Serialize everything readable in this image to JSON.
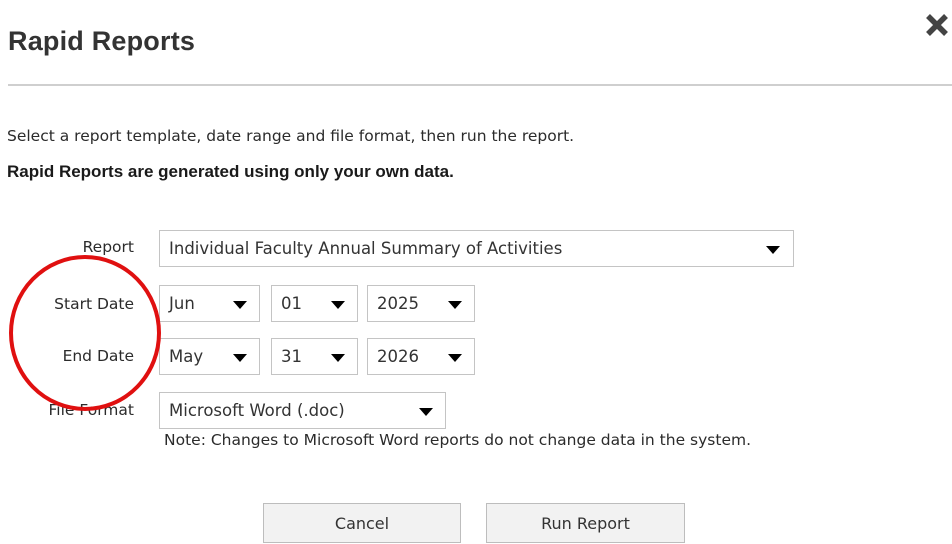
{
  "dialog": {
    "title": "Rapid Reports",
    "close_icon": "close-icon",
    "intro_text": "Select a report template, date range and file format, then run the report.",
    "intro_bold": "Rapid Reports are generated using only your own data."
  },
  "form": {
    "report": {
      "label": "Report",
      "value": "Individual Faculty Annual Summary of Activities"
    },
    "start_date": {
      "label": "Start Date",
      "month": "Jun",
      "day": "01",
      "year": "2025"
    },
    "end_date": {
      "label": "End Date",
      "month": "May",
      "day": "31",
      "year": "2026"
    },
    "file_format": {
      "label": "File Format",
      "value": "Microsoft Word (.doc)",
      "note": "Note: Changes to Microsoft Word reports do not change data in the system."
    }
  },
  "buttons": {
    "cancel": "Cancel",
    "run": "Run Report"
  },
  "colors": {
    "annotation_circle": "#e01010",
    "divider": "#cfcfcf",
    "button_bg": "#f2f2f2"
  }
}
